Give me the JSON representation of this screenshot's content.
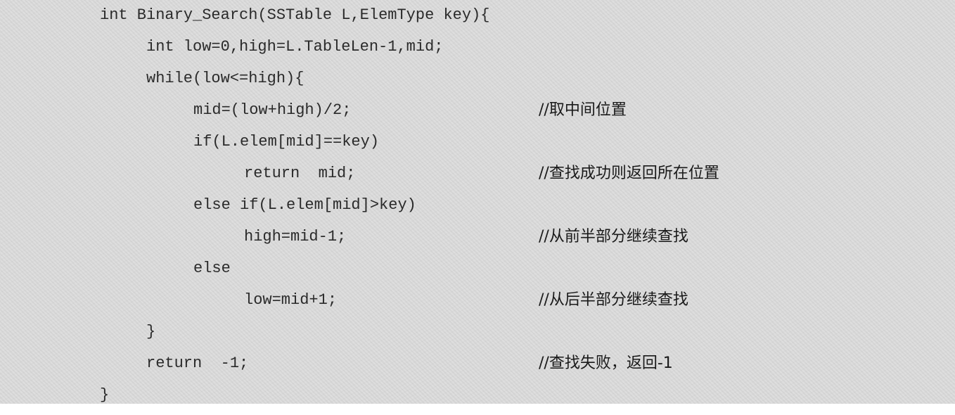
{
  "code": {
    "lines": [
      "int Binary_Search(SSTable L,ElemType key){",
      "int low=0,high=L.TableLen-1,mid;",
      "while(low<=high){",
      "mid=(low+high)/2;",
      "if(L.elem[mid]==key)",
      "return  mid;",
      "else if(L.elem[mid]>key)",
      "high=mid-1;",
      "else",
      "low=mid+1;",
      "}",
      "return  -1;",
      "}"
    ],
    "comments": {
      "mid": "//取中间位置",
      "found": "//查找成功则返回所在位置",
      "front": "//从前半部分继续查找",
      "back": "//从后半部分继续查找",
      "fail": "//查找失败，返回-1"
    }
  }
}
